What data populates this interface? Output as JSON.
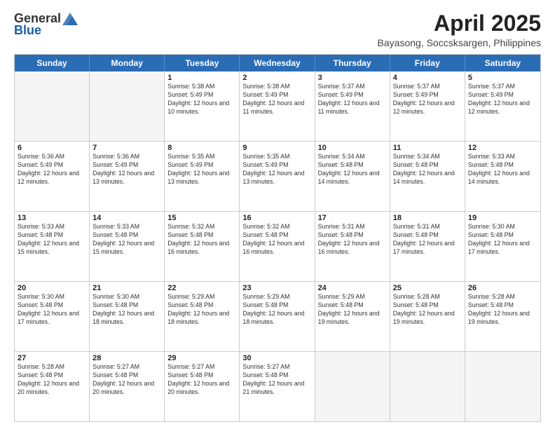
{
  "logo": {
    "general": "General",
    "blue": "Blue"
  },
  "title": {
    "month_year": "April 2025",
    "location": "Bayasong, Soccsksargen, Philippines"
  },
  "weekdays": [
    "Sunday",
    "Monday",
    "Tuesday",
    "Wednesday",
    "Thursday",
    "Friday",
    "Saturday"
  ],
  "weeks": [
    [
      {
        "day": "",
        "detail": ""
      },
      {
        "day": "",
        "detail": ""
      },
      {
        "day": "1",
        "detail": "Sunrise: 5:38 AM\nSunset: 5:49 PM\nDaylight: 12 hours\nand 10 minutes."
      },
      {
        "day": "2",
        "detail": "Sunrise: 5:38 AM\nSunset: 5:49 PM\nDaylight: 12 hours\nand 11 minutes."
      },
      {
        "day": "3",
        "detail": "Sunrise: 5:37 AM\nSunset: 5:49 PM\nDaylight: 12 hours\nand 11 minutes."
      },
      {
        "day": "4",
        "detail": "Sunrise: 5:37 AM\nSunset: 5:49 PM\nDaylight: 12 hours\nand 12 minutes."
      },
      {
        "day": "5",
        "detail": "Sunrise: 5:37 AM\nSunset: 5:49 PM\nDaylight: 12 hours\nand 12 minutes."
      }
    ],
    [
      {
        "day": "6",
        "detail": "Sunrise: 5:36 AM\nSunset: 5:49 PM\nDaylight: 12 hours\nand 12 minutes."
      },
      {
        "day": "7",
        "detail": "Sunrise: 5:36 AM\nSunset: 5:49 PM\nDaylight: 12 hours\nand 13 minutes."
      },
      {
        "day": "8",
        "detail": "Sunrise: 5:35 AM\nSunset: 5:49 PM\nDaylight: 12 hours\nand 13 minutes."
      },
      {
        "day": "9",
        "detail": "Sunrise: 5:35 AM\nSunset: 5:49 PM\nDaylight: 12 hours\nand 13 minutes."
      },
      {
        "day": "10",
        "detail": "Sunrise: 5:34 AM\nSunset: 5:48 PM\nDaylight: 12 hours\nand 14 minutes."
      },
      {
        "day": "11",
        "detail": "Sunrise: 5:34 AM\nSunset: 5:48 PM\nDaylight: 12 hours\nand 14 minutes."
      },
      {
        "day": "12",
        "detail": "Sunrise: 5:33 AM\nSunset: 5:48 PM\nDaylight: 12 hours\nand 14 minutes."
      }
    ],
    [
      {
        "day": "13",
        "detail": "Sunrise: 5:33 AM\nSunset: 5:48 PM\nDaylight: 12 hours\nand 15 minutes."
      },
      {
        "day": "14",
        "detail": "Sunrise: 5:33 AM\nSunset: 5:48 PM\nDaylight: 12 hours\nand 15 minutes."
      },
      {
        "day": "15",
        "detail": "Sunrise: 5:32 AM\nSunset: 5:48 PM\nDaylight: 12 hours\nand 16 minutes."
      },
      {
        "day": "16",
        "detail": "Sunrise: 5:32 AM\nSunset: 5:48 PM\nDaylight: 12 hours\nand 16 minutes."
      },
      {
        "day": "17",
        "detail": "Sunrise: 5:31 AM\nSunset: 5:48 PM\nDaylight: 12 hours\nand 16 minutes."
      },
      {
        "day": "18",
        "detail": "Sunrise: 5:31 AM\nSunset: 5:48 PM\nDaylight: 12 hours\nand 17 minutes."
      },
      {
        "day": "19",
        "detail": "Sunrise: 5:30 AM\nSunset: 5:48 PM\nDaylight: 12 hours\nand 17 minutes."
      }
    ],
    [
      {
        "day": "20",
        "detail": "Sunrise: 5:30 AM\nSunset: 5:48 PM\nDaylight: 12 hours\nand 17 minutes."
      },
      {
        "day": "21",
        "detail": "Sunrise: 5:30 AM\nSunset: 5:48 PM\nDaylight: 12 hours\nand 18 minutes."
      },
      {
        "day": "22",
        "detail": "Sunrise: 5:29 AM\nSunset: 5:48 PM\nDaylight: 12 hours\nand 18 minutes."
      },
      {
        "day": "23",
        "detail": "Sunrise: 5:29 AM\nSunset: 5:48 PM\nDaylight: 12 hours\nand 18 minutes."
      },
      {
        "day": "24",
        "detail": "Sunrise: 5:29 AM\nSunset: 5:48 PM\nDaylight: 12 hours\nand 19 minutes."
      },
      {
        "day": "25",
        "detail": "Sunrise: 5:28 AM\nSunset: 5:48 PM\nDaylight: 12 hours\nand 19 minutes."
      },
      {
        "day": "26",
        "detail": "Sunrise: 5:28 AM\nSunset: 5:48 PM\nDaylight: 12 hours\nand 19 minutes."
      }
    ],
    [
      {
        "day": "27",
        "detail": "Sunrise: 5:28 AM\nSunset: 5:48 PM\nDaylight: 12 hours\nand 20 minutes."
      },
      {
        "day": "28",
        "detail": "Sunrise: 5:27 AM\nSunset: 5:48 PM\nDaylight: 12 hours\nand 20 minutes."
      },
      {
        "day": "29",
        "detail": "Sunrise: 5:27 AM\nSunset: 5:48 PM\nDaylight: 12 hours\nand 20 minutes."
      },
      {
        "day": "30",
        "detail": "Sunrise: 5:27 AM\nSunset: 5:48 PM\nDaylight: 12 hours\nand 21 minutes."
      },
      {
        "day": "",
        "detail": ""
      },
      {
        "day": "",
        "detail": ""
      },
      {
        "day": "",
        "detail": ""
      }
    ]
  ]
}
